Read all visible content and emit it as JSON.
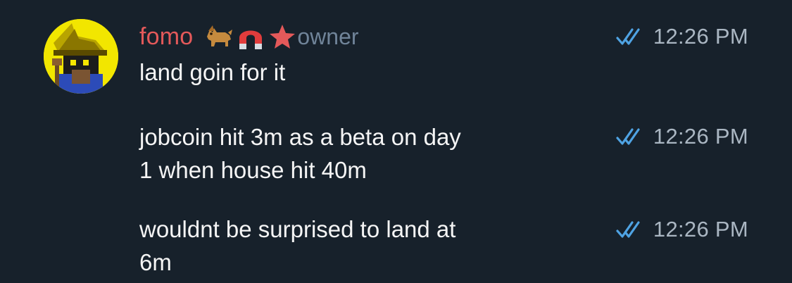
{
  "chat": {
    "sender": {
      "name": "fomo",
      "role": "owner",
      "badges": [
        "dog-emoji-icon",
        "magnet-emoji-icon",
        "star-icon"
      ],
      "avatar": "pixel-wizard-avatar"
    },
    "messages": [
      {
        "text": "land goin for it",
        "time": "12:26 PM",
        "status": "read"
      },
      {
        "text": "jobcoin hit 3m as a beta on day\n1 when house hit 40m",
        "time": "12:26 PM",
        "status": "read"
      },
      {
        "text": "wouldnt be surprised to land at\n6m",
        "time": "12:26 PM",
        "status": "read"
      }
    ]
  },
  "colors": {
    "background": "#17212b",
    "sender_name": "#e4595a",
    "role": "#708499",
    "message_text": "#f5f5f5",
    "timestamp": "#aab6c2",
    "read_ticks": "#4fa3e3"
  }
}
